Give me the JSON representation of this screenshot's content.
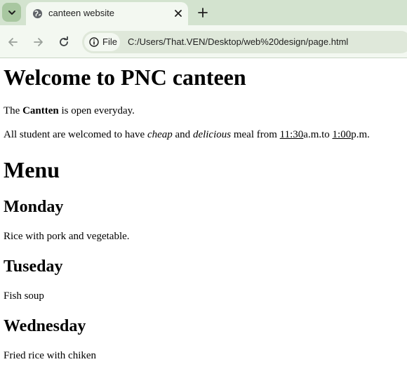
{
  "browser": {
    "tab_title": "canteen website",
    "address_chip_label": "File",
    "url": "C:/Users/That.VEN/Desktop/web%20design/page.html"
  },
  "page": {
    "heading": "Welcome to PNC canteen",
    "line1": {
      "before": "The ",
      "bold": "Cantten",
      "after": " is open everyday."
    },
    "line2": {
      "t1": "All student are welcomed to have ",
      "cheap": "cheap",
      "t2": " and ",
      "delicious": "delicious",
      "t3": " meal from ",
      "open_time": "11:30",
      "t4": "a.m.to ",
      "close_time": "1:00",
      "t5": "p.m."
    },
    "menu_heading": "Menu",
    "days": [
      {
        "day": "Monday",
        "dish": "Rice with pork and vegetable."
      },
      {
        "day": "Tuseday",
        "dish": "Fish soup"
      },
      {
        "day": "Wednesday",
        "dish": "Fried rice with chiken"
      }
    ]
  }
}
